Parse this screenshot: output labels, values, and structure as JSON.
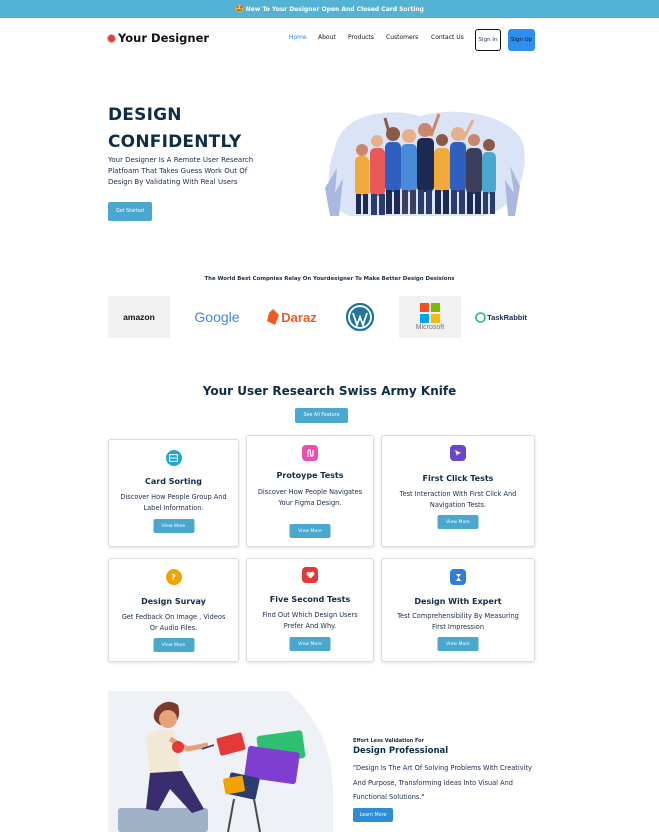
{
  "banner": {
    "emoji": "🤩",
    "text": "New To Your Designer Open And Closed Card Sorting"
  },
  "header": {
    "logo_text": "Your Designer",
    "nav": [
      "Home",
      "About",
      "Products",
      "Customers",
      "Contact Us"
    ],
    "sign_in": "Sign In",
    "sign_up": "Sign Up"
  },
  "hero": {
    "title_line1": "DESIGN",
    "title_line2": "CONFIDENTLY",
    "description": "Your Designer Is A Remote User Research Platfoam That Takes Guess Work Out Of Design By Validating With Real Users",
    "cta": "Get Started"
  },
  "trusted": {
    "text": "The World Best Compnies Relay On Yourdesigner To Make Better Design Desisions",
    "logos": [
      "amazon",
      "Google",
      "Daraz",
      "WordPress",
      "Microsoft",
      "TaskRabbit"
    ]
  },
  "features": {
    "title": "Your User Research Swiss Army Knife",
    "see_all": "See All Feature",
    "cards": [
      {
        "title": "Card Sorting",
        "desc": "Discover How People Group And Label Information.",
        "btn": "View More",
        "icon": "card-sorting-icon",
        "color": "#1fa6d9"
      },
      {
        "title": "Protoype Tests",
        "desc": "Discover How People Navigates Your Figma Design.",
        "btn": "View More",
        "icon": "prototype-icon",
        "color": "#e84fb0"
      },
      {
        "title": "First Click Tests",
        "desc": "Test Interaction With First Click And Navigation Tests.",
        "btn": "View More",
        "icon": "cursor-click-icon",
        "color": "#6a47c9"
      },
      {
        "title": "Design Survay",
        "desc": "Get Fedback On Image , Videos Or Audio Files.",
        "btn": "View More",
        "icon": "question-icon",
        "color": "#f2a300"
      },
      {
        "title": "Five Second Tests",
        "desc": "Find Out Which Design Users Prefer And Why.",
        "btn": "View More",
        "icon": "heart-icon",
        "color": "#e53935"
      },
      {
        "title": "Design With Expert",
        "desc": "Test Comprehensibility By Measuring First Impression",
        "btn": "View More",
        "icon": "hourglass-icon",
        "color": "#2e7fd9"
      }
    ]
  },
  "effortless": {
    "label": "Effort Less Validation For",
    "title": "Design Professional",
    "quote": "\"Design Is The Art Of Solving Problems With Creativity And Purpose, Transforming Ideas Into Visual And Functional Solutions.\"",
    "cta": "Learn More"
  },
  "colors": {
    "banner": "#54b3d4",
    "accent": "#4aa8cf",
    "signup": "#2d8ef0",
    "heading": "#0f2d4a"
  }
}
